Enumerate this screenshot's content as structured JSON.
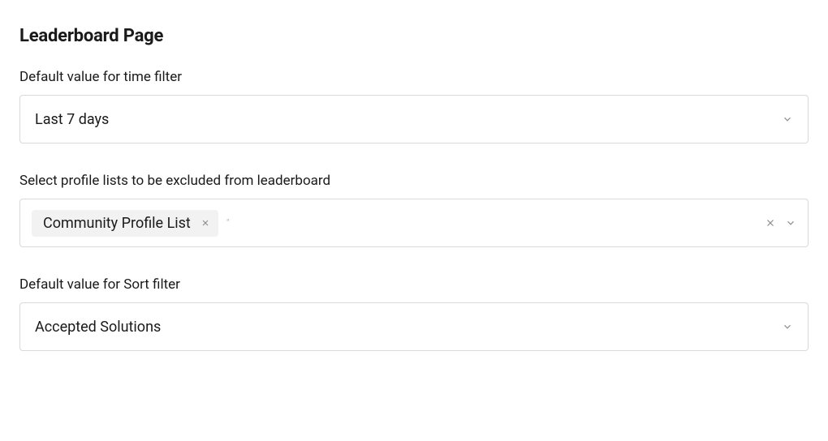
{
  "title": "Leaderboard Page",
  "timeFilter": {
    "label": "Default value for time filter",
    "value": "Last 7 days"
  },
  "excludeLists": {
    "label": "Select profile lists to be excluded from leaderboard",
    "tags": [
      {
        "label": "Community Profile List"
      }
    ]
  },
  "sortFilter": {
    "label": "Default value for Sort filter",
    "value": "Accepted Solutions"
  }
}
